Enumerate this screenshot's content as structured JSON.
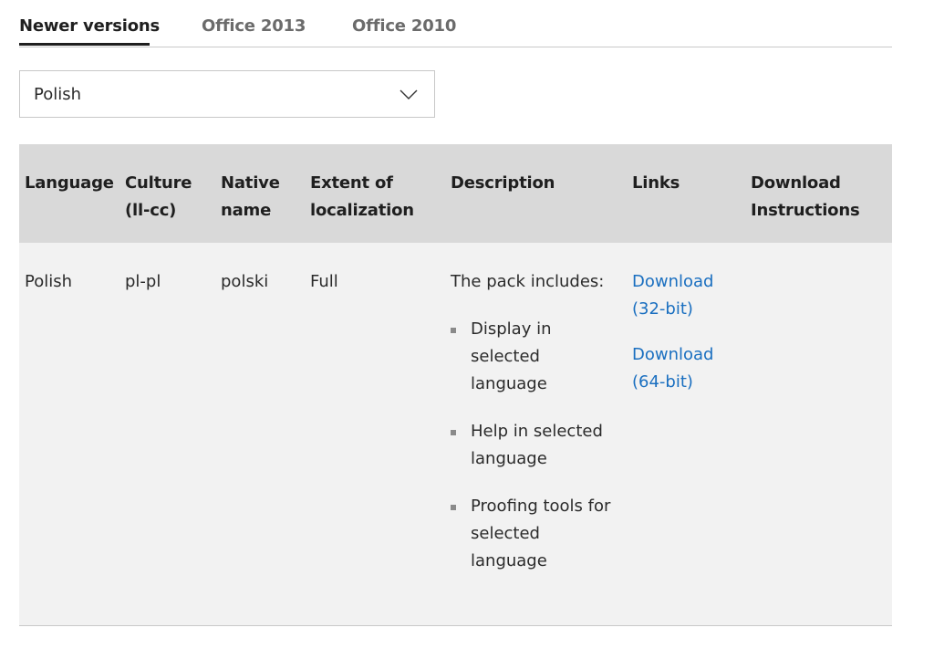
{
  "tabs": [
    {
      "label": "Newer versions",
      "active": true
    },
    {
      "label": "Office 2013",
      "active": false
    },
    {
      "label": "Office 2010",
      "active": false
    }
  ],
  "language_select": {
    "selected": "Polish",
    "icon": "chevron-down-icon"
  },
  "table": {
    "headers": {
      "language": [
        "Language"
      ],
      "culture": [
        "Culture",
        "(ll-cc)"
      ],
      "native_name": [
        "Native",
        "name"
      ],
      "extent": [
        "Extent of",
        "localization"
      ],
      "description": [
        "Description"
      ],
      "links": [
        "Links"
      ],
      "instructions": [
        "Download",
        "Instructions"
      ]
    },
    "row": {
      "language": "Polish",
      "culture": "pl-pl",
      "native_name": "polski",
      "extent": "Full",
      "description_intro": "The pack includes:",
      "description_items": [
        [
          "Display in",
          "selected",
          "language"
        ],
        [
          "Help in selected",
          "language"
        ],
        [
          "Proofing tools for",
          "selected",
          "language"
        ]
      ],
      "links": [
        [
          "Download",
          "(32-bit)"
        ],
        [
          "Download",
          "(64-bit)"
        ]
      ]
    }
  },
  "colors": {
    "header_bg": "#d9d9d9",
    "body_bg": "#f2f2f2",
    "link": "#1a6fc0",
    "tab_active": "#1f1f1f",
    "tab_inactive": "#6b6b6b"
  }
}
